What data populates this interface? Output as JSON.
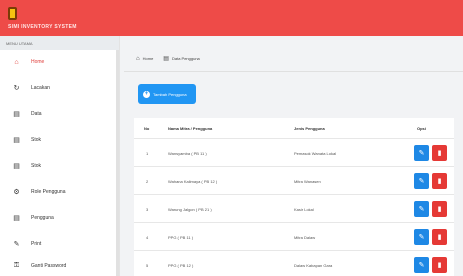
{
  "app": {
    "title": "SIMI INVENTORY SYSTEM"
  },
  "sidebar": {
    "header": "MENU UTAMA",
    "items": [
      {
        "label": "Home",
        "icon": "home-icon",
        "glyph": "⌂"
      },
      {
        "label": "Lacakan",
        "icon": "refresh-icon",
        "glyph": "↻"
      },
      {
        "label": "Data",
        "icon": "file-icon",
        "glyph": "▤"
      },
      {
        "label": "Stok",
        "icon": "file-icon",
        "glyph": "▤"
      },
      {
        "label": "Stok",
        "icon": "file-icon",
        "glyph": "▤"
      },
      {
        "label": "Role Pengguna",
        "icon": "gear-icon",
        "glyph": "⚙"
      },
      {
        "label": "Pengguna",
        "icon": "document-icon",
        "glyph": "▤"
      },
      {
        "label": "Print",
        "icon": "pencil-icon",
        "glyph": "✎"
      },
      {
        "label": "Ganti Password",
        "icon": "key-icon",
        "glyph": "⚿"
      }
    ]
  },
  "breadcrumb": {
    "home": "Home",
    "current": "Data Pengguna"
  },
  "toolbar": {
    "add_label": "Tambah Pengguna"
  },
  "table": {
    "headers": [
      "No",
      "Nama Mitra / Pengguna",
      "Jenis Pengguna",
      "Opsi"
    ],
    "rows": [
      {
        "no": "1",
        "name": "Wansyamba ( PB 11 )",
        "type": "Pemasok Wanata Lokal"
      },
      {
        "no": "2",
        "name": "Wahana Kalimaya ( PB 12 )",
        "type": "Mitra Wanasen"
      },
      {
        "no": "3",
        "name": "Warung Jalgon ( PB 21 )",
        "type": "Kasir Lokal"
      },
      {
        "no": "4",
        "name": "PPG ( PB 11 )",
        "type": "Mitra Dalaw"
      },
      {
        "no": "5",
        "name": "PPG ( PB 12 )",
        "type": "Dalaw Kabapan Gara"
      }
    ]
  },
  "colors": {
    "topbar": "#ee4b48",
    "accent_blue": "#2196f3",
    "edit_button": "#1e88e5",
    "delete_button": "#e53935",
    "active_menu": "#e0413e"
  }
}
